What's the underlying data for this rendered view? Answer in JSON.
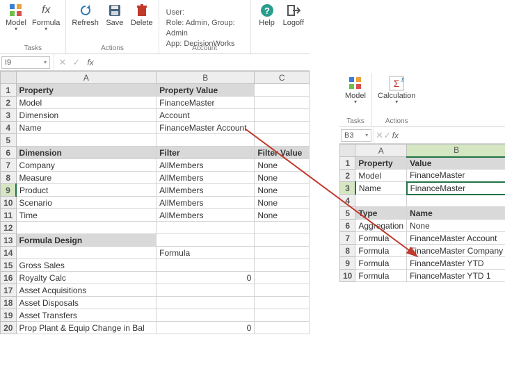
{
  "left": {
    "ribbon": {
      "tasks_label": "Tasks",
      "actions_label": "Actions",
      "account_label": "Account",
      "btn_model": "Model",
      "btn_formula": "Formula",
      "btn_refresh": "Refresh",
      "btn_save": "Save",
      "btn_delete": "Delete",
      "btn_help": "Help",
      "btn_logoff": "Logoff",
      "acct_user": "User:",
      "acct_role": "Role: Admin, Group: Admin",
      "acct_app": "App: DecisionWorks"
    },
    "namebox": "I9",
    "cols": {
      "A": "A",
      "B": "B",
      "C": "C"
    },
    "rows": [
      {
        "n": "1",
        "A": "Property",
        "B": "Property Value",
        "C": "",
        "hdr": [
          "A",
          "B"
        ]
      },
      {
        "n": "2",
        "A": "Model",
        "B": "FinanceMaster",
        "C": ""
      },
      {
        "n": "3",
        "A": "Dimension",
        "B": "Account",
        "C": ""
      },
      {
        "n": "4",
        "A": "Name",
        "B": "FinanceMaster Account",
        "C": ""
      },
      {
        "n": "5",
        "A": "",
        "B": "",
        "C": ""
      },
      {
        "n": "6",
        "A": "Dimension",
        "B": "Filter",
        "C": "Filter Value",
        "hdr": [
          "A",
          "B",
          "C"
        ]
      },
      {
        "n": "7",
        "A": "Company",
        "B": "AllMembers",
        "C": "None"
      },
      {
        "n": "8",
        "A": "Measure",
        "B": "AllMembers",
        "C": "None"
      },
      {
        "n": "9",
        "A": "Product",
        "B": "AllMembers",
        "C": "None",
        "active": true
      },
      {
        "n": "10",
        "A": "Scenario",
        "B": "AllMembers",
        "C": "None"
      },
      {
        "n": "11",
        "A": "Time",
        "B": "AllMembers",
        "C": "None"
      },
      {
        "n": "12",
        "A": "",
        "B": "",
        "C": ""
      },
      {
        "n": "13",
        "A": "Formula Design",
        "B": "",
        "C": "",
        "hdr": [
          "A"
        ]
      },
      {
        "n": "14",
        "A": "",
        "B": "Formula",
        "C": ""
      },
      {
        "n": "15",
        "A": "Gross Sales",
        "B": "",
        "C": ""
      },
      {
        "n": "16",
        "A": "Royalty Calc",
        "B": "0",
        "C": "",
        "num": [
          "B"
        ]
      },
      {
        "n": "17",
        "A": "Asset Acquisitions",
        "B": "",
        "C": ""
      },
      {
        "n": "18",
        "A": "Asset Disposals",
        "B": "",
        "C": ""
      },
      {
        "n": "19",
        "A": "Asset Transfers",
        "B": "",
        "C": ""
      },
      {
        "n": "20",
        "A": "Prop Plant & Equip Change in Bal",
        "B": "0",
        "C": "",
        "num": [
          "B"
        ]
      }
    ]
  },
  "right": {
    "ribbon": {
      "tasks_label": "Tasks",
      "actions_label": "Actions",
      "btn_model": "Model",
      "btn_calc": "Calculation"
    },
    "namebox": "B3",
    "cols": {
      "A": "A",
      "B": "B"
    },
    "rows": [
      {
        "n": "1",
        "A": "Property",
        "B": "Value",
        "hdr": [
          "A",
          "B"
        ]
      },
      {
        "n": "2",
        "A": "Model",
        "B": "FinanceMaster"
      },
      {
        "n": "3",
        "A": "Name",
        "B": "FinanceMaster",
        "active": true,
        "sel": "B"
      },
      {
        "n": "4",
        "A": "",
        "B": ""
      },
      {
        "n": "5",
        "A": "Type",
        "B": "Name",
        "hdr": [
          "A",
          "B"
        ]
      },
      {
        "n": "6",
        "A": "Aggregation",
        "B": "None"
      },
      {
        "n": "7",
        "A": "Formula",
        "B": "FinanceMaster Account"
      },
      {
        "n": "8",
        "A": "Formula",
        "B": "FinanceMaster Company"
      },
      {
        "n": "9",
        "A": "Formula",
        "B": "FinanceMaster YTD"
      },
      {
        "n": "10",
        "A": "Formula",
        "B": "FinanceMaster YTD 1"
      }
    ]
  }
}
